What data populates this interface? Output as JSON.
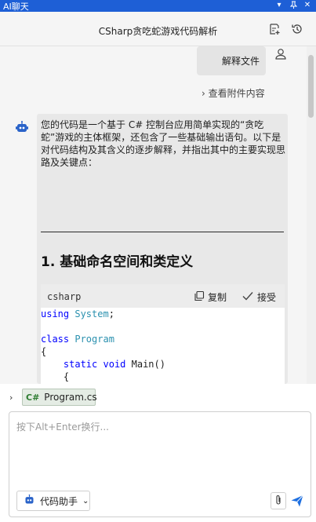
{
  "window": {
    "title": "AI聊天",
    "buttons": [
      "▾",
      "📌",
      "✕"
    ]
  },
  "header": {
    "conversation_title": "CSharp贪吃蛇游戏代码解析",
    "icons": [
      "new-chat-icon",
      "history-icon"
    ]
  },
  "messages": {
    "user": {
      "text": "解释文件",
      "attachment_link": "查看附件内容"
    },
    "assistant": {
      "paragraph": "您的代码是一个基于 C# 控制台应用简单实现的“贪吃蛇”游戏的主体框架，还包含了一些基础输出语句。以下是对代码结构及其含义的逐步解释，并指出其中的主要实现思路及关键点：",
      "heading": "1. 基础命名空间和类定义",
      "code": {
        "language": "csharp",
        "copy_label": "复制",
        "accept_label": "接受",
        "lines": [
          [
            {
              "t": "kw",
              "v": "using"
            },
            {
              "t": "pl",
              "v": " "
            },
            {
              "t": "ty",
              "v": "System"
            },
            {
              "t": "pl",
              "v": ";"
            }
          ],
          [],
          [
            {
              "t": "kw",
              "v": "class"
            },
            {
              "t": "pl",
              "v": " "
            },
            {
              "t": "ty",
              "v": "Program"
            }
          ],
          [
            {
              "t": "pl",
              "v": "{"
            }
          ],
          [
            {
              "t": "pl",
              "v": "    "
            },
            {
              "t": "kw",
              "v": "static"
            },
            {
              "t": "pl",
              "v": " "
            },
            {
              "t": "kw",
              "v": "void"
            },
            {
              "t": "pl",
              "v": " Main()"
            }
          ],
          [
            {
              "t": "pl",
              "v": "    {"
            }
          ],
          [
            {
              "t": "pl",
              "v": "        "
            },
            {
              "t": "cm",
              "v": "// ..."
            }
          ],
          [
            {
              "t": "pl",
              "v": "    }"
            }
          ],
          [
            {
              "t": "pl",
              "v": "}"
            }
          ]
        ]
      }
    }
  },
  "attached_file": {
    "badge": "C#",
    "name": "Program.cs"
  },
  "input": {
    "placeholder": "按下Alt+Enter换行...",
    "value": "",
    "assistant_selector": "代码助手"
  },
  "colors": {
    "titlebar": "#1e5fd6",
    "send": "#1e6fe0",
    "bot_icon": "#2a63c9"
  }
}
